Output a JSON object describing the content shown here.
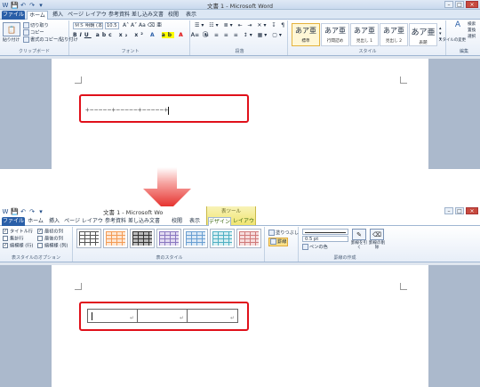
{
  "top": {
    "qat": [
      "W",
      "💾",
      "↶",
      "↷",
      "▾"
    ],
    "title": "文書 1 - Microsoft Word",
    "tabs": [
      "ファイル",
      "ホーム",
      "挿入",
      "ページ レイアウト",
      "参考資料",
      "差し込み文書",
      "校閲",
      "表示"
    ],
    "clipboard": {
      "paste": "貼り付け",
      "cut": "切り取り",
      "copy": "コピー",
      "format": "書式のコピー/貼り付け",
      "label": "クリップボード"
    },
    "font": {
      "name": "ＭＳ 明朝 (本文)",
      "size": "10.5",
      "label": "フォント"
    },
    "paragraph_label": "段落",
    "styles": [
      {
        "sample": "あア亜",
        "name": "標準"
      },
      {
        "sample": "あア亜",
        "name": "行間詰め"
      },
      {
        "sample": "あア亜",
        "name": "見出し 1"
      },
      {
        "sample": "あア亜",
        "name": "見出し 2"
      },
      {
        "sample": "あア亜",
        "name": "表題"
      }
    ],
    "styles_label": "スタイル",
    "change_styles": "スタイルの変更",
    "editing": {
      "find": "検索",
      "replace": "置換",
      "select": "選択",
      "label": "編集"
    },
    "typed_line": "+−−−−−+−−−−−+−−−−−+"
  },
  "bottom": {
    "qat": [
      "W",
      "💾",
      "↶",
      "↷",
      "▾"
    ],
    "title": "文書 1 - Microsoft Wo",
    "context_header": "表ツール",
    "tabs": [
      "ファイル",
      "ホーム",
      "挿入",
      "ページ レイアウト",
      "参考資料",
      "差し込み文書",
      "校閲",
      "表示",
      "デザイン",
      "レイアウト"
    ],
    "options": [
      {
        "label": "タイトル行",
        "checked": true
      },
      {
        "label": "最初の列",
        "checked": true
      },
      {
        "label": "集計行",
        "checked": false
      },
      {
        "label": "最後の列",
        "checked": false
      },
      {
        "label": "縞模様 (行)",
        "checked": true
      },
      {
        "label": "縞模様 (列)",
        "checked": false
      }
    ],
    "options_label": "表スタイルのオプション",
    "table_styles_label": "表のスタイル",
    "shading": "塗りつぶし",
    "borders": "罫線",
    "pen_weight": "0.5 pt",
    "pen_color": "ペンの色",
    "draw_table": "罫線を引く",
    "eraser": "罫線の削除",
    "borders_label": "罫線の作成",
    "cell_mark": "↵"
  }
}
